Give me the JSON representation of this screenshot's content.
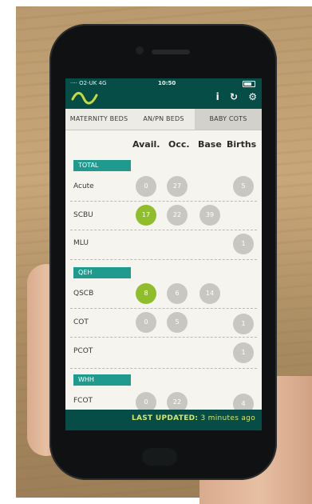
{
  "status_bar": {
    "carrier": "···· O2-UK 4G",
    "time": "10:50"
  },
  "toolbar": {
    "info_icon": "i",
    "refresh_icon": "↻",
    "settings_icon": "⚙"
  },
  "tabs": [
    {
      "label": "MATERNITY BEDS"
    },
    {
      "label": "AN/PN BEDS"
    },
    {
      "label": "BABY COTS"
    }
  ],
  "columns": {
    "avail": "Avail.",
    "occ": "Occ.",
    "base": "Base",
    "births": "Births"
  },
  "sections": [
    {
      "title": "TOTAL",
      "rows": [
        {
          "label": "Acute",
          "avail": "0",
          "occ": "27",
          "base": "",
          "births": "5"
        },
        {
          "label": "SCBU",
          "avail": "17",
          "occ": "22",
          "base": "39",
          "births": ""
        },
        {
          "label": "MLU",
          "avail": "",
          "occ": "",
          "base": "",
          "births": "1"
        }
      ]
    },
    {
      "title": "QEH",
      "rows": [
        {
          "label": "QSCB",
          "avail": "8",
          "occ": "6",
          "base": "14",
          "births": ""
        },
        {
          "label": "COT",
          "avail": "0",
          "occ": "5",
          "base": "",
          "births": "1"
        },
        {
          "label": "PCOT",
          "avail": "",
          "occ": "",
          "base": "",
          "births": "1"
        }
      ]
    },
    {
      "title": "WHH",
      "rows": [
        {
          "label": "FCOT",
          "avail": "0",
          "occ": "22",
          "base": "",
          "births": "4"
        }
      ]
    }
  ],
  "footer": {
    "label": "LAST UPDATED:",
    "value": "3 minutes ago"
  },
  "colors": {
    "app_bar": "#064c47",
    "accent": "#1f9a8f",
    "highlight": "#8fbd2c",
    "footer_text": "#d7e66c"
  }
}
